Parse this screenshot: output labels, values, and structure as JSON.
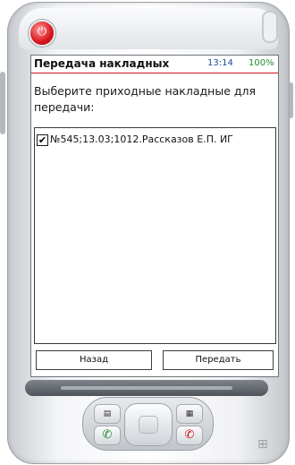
{
  "device": {
    "power_icon": "power-icon",
    "call_icon": "phone-call-icon",
    "end_icon": "phone-end-icon",
    "softkey_left_icon": "calendar-icon",
    "softkey_right_icon": "contacts-icon",
    "logo_icon": "windows-logo-icon"
  },
  "title_bar": {
    "title": "Передача накладных",
    "time": "13:14",
    "battery": "100%",
    "accent_color": "#d4161d"
  },
  "instruction": "Выберите приходные накладные для передачи:",
  "invoices": [
    {
      "checked": true,
      "label": "№545;13.03;1012.Рассказов Е.П. ИГ"
    }
  ],
  "buttons": {
    "back": "Назад",
    "send": "Передать"
  }
}
